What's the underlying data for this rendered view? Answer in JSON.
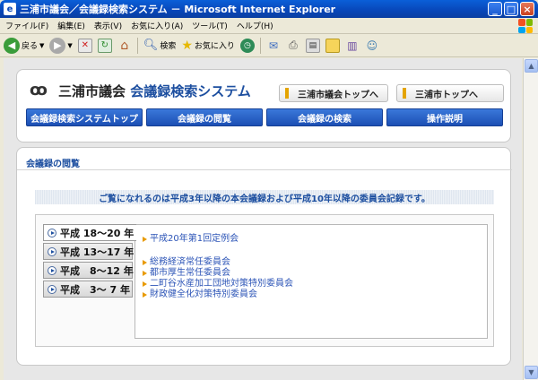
{
  "window": {
    "title": "三浦市議会／会議録検索システム － Microsoft Internet Explorer"
  },
  "menu": {
    "items": [
      "ファイル(F)",
      "編集(E)",
      "表示(V)",
      "お気に入り(A)",
      "ツール(T)",
      "ヘルプ(H)"
    ]
  },
  "toolbar": {
    "back_label": "戻る",
    "search_label": "検索",
    "favorites_label": "お気に入り"
  },
  "header": {
    "logo_mark": "ꝏ",
    "site_title_main": "三浦市議会",
    "site_title_sub": "会議録検索システム",
    "top_link_council": "三浦市議会トップへ",
    "top_link_city": "三浦市トップへ"
  },
  "nav": {
    "items": [
      "会議録検索システムトップ",
      "会議録の閲覧",
      "会議録の検索",
      "操作説明"
    ]
  },
  "main": {
    "section_title": "会議録の閲覧",
    "notice": "ご覧になれるのは平成3年以降の本会議録および平成10年以降の委員会記録です。",
    "years": [
      "平成 18～20 年",
      "平成 13～17 年",
      "平成　8～12 年",
      "平成　3～ 7 年"
    ],
    "sessions": [
      "平成20年第1回定例会",
      "総務経済常任委員会",
      "都市厚生常任委員会",
      "二町谷水産加工団地対策特別委員会",
      "財政健全化対策特別委員会"
    ]
  },
  "colors": {
    "accent": "#1d4fa0",
    "link": "#2d55b7",
    "marker": "#e89a00"
  }
}
